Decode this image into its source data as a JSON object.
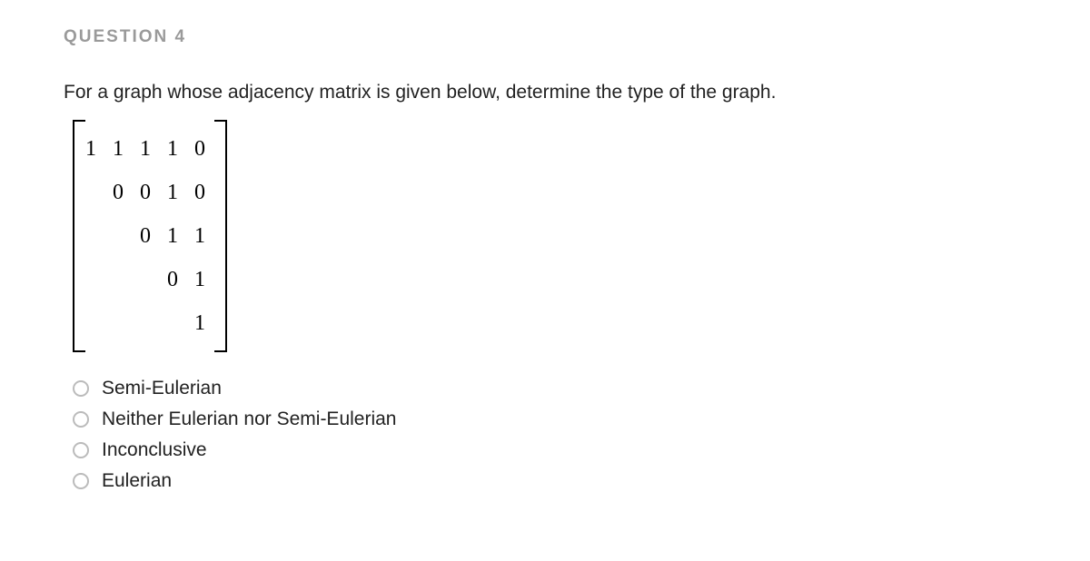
{
  "header": "QUESTION 4",
  "prompt": "For a graph whose adjacency matrix is given below, determine the type of the graph.",
  "matrix": {
    "rows": [
      "1 1 1 1 0",
      "0 0 1 0",
      "0 1 1",
      "0 1",
      "1"
    ]
  },
  "options": [
    {
      "label": "Semi-Eulerian"
    },
    {
      "label": "Neither Eulerian nor Semi-Eulerian"
    },
    {
      "label": "Inconclusive"
    },
    {
      "label": "Eulerian"
    }
  ]
}
